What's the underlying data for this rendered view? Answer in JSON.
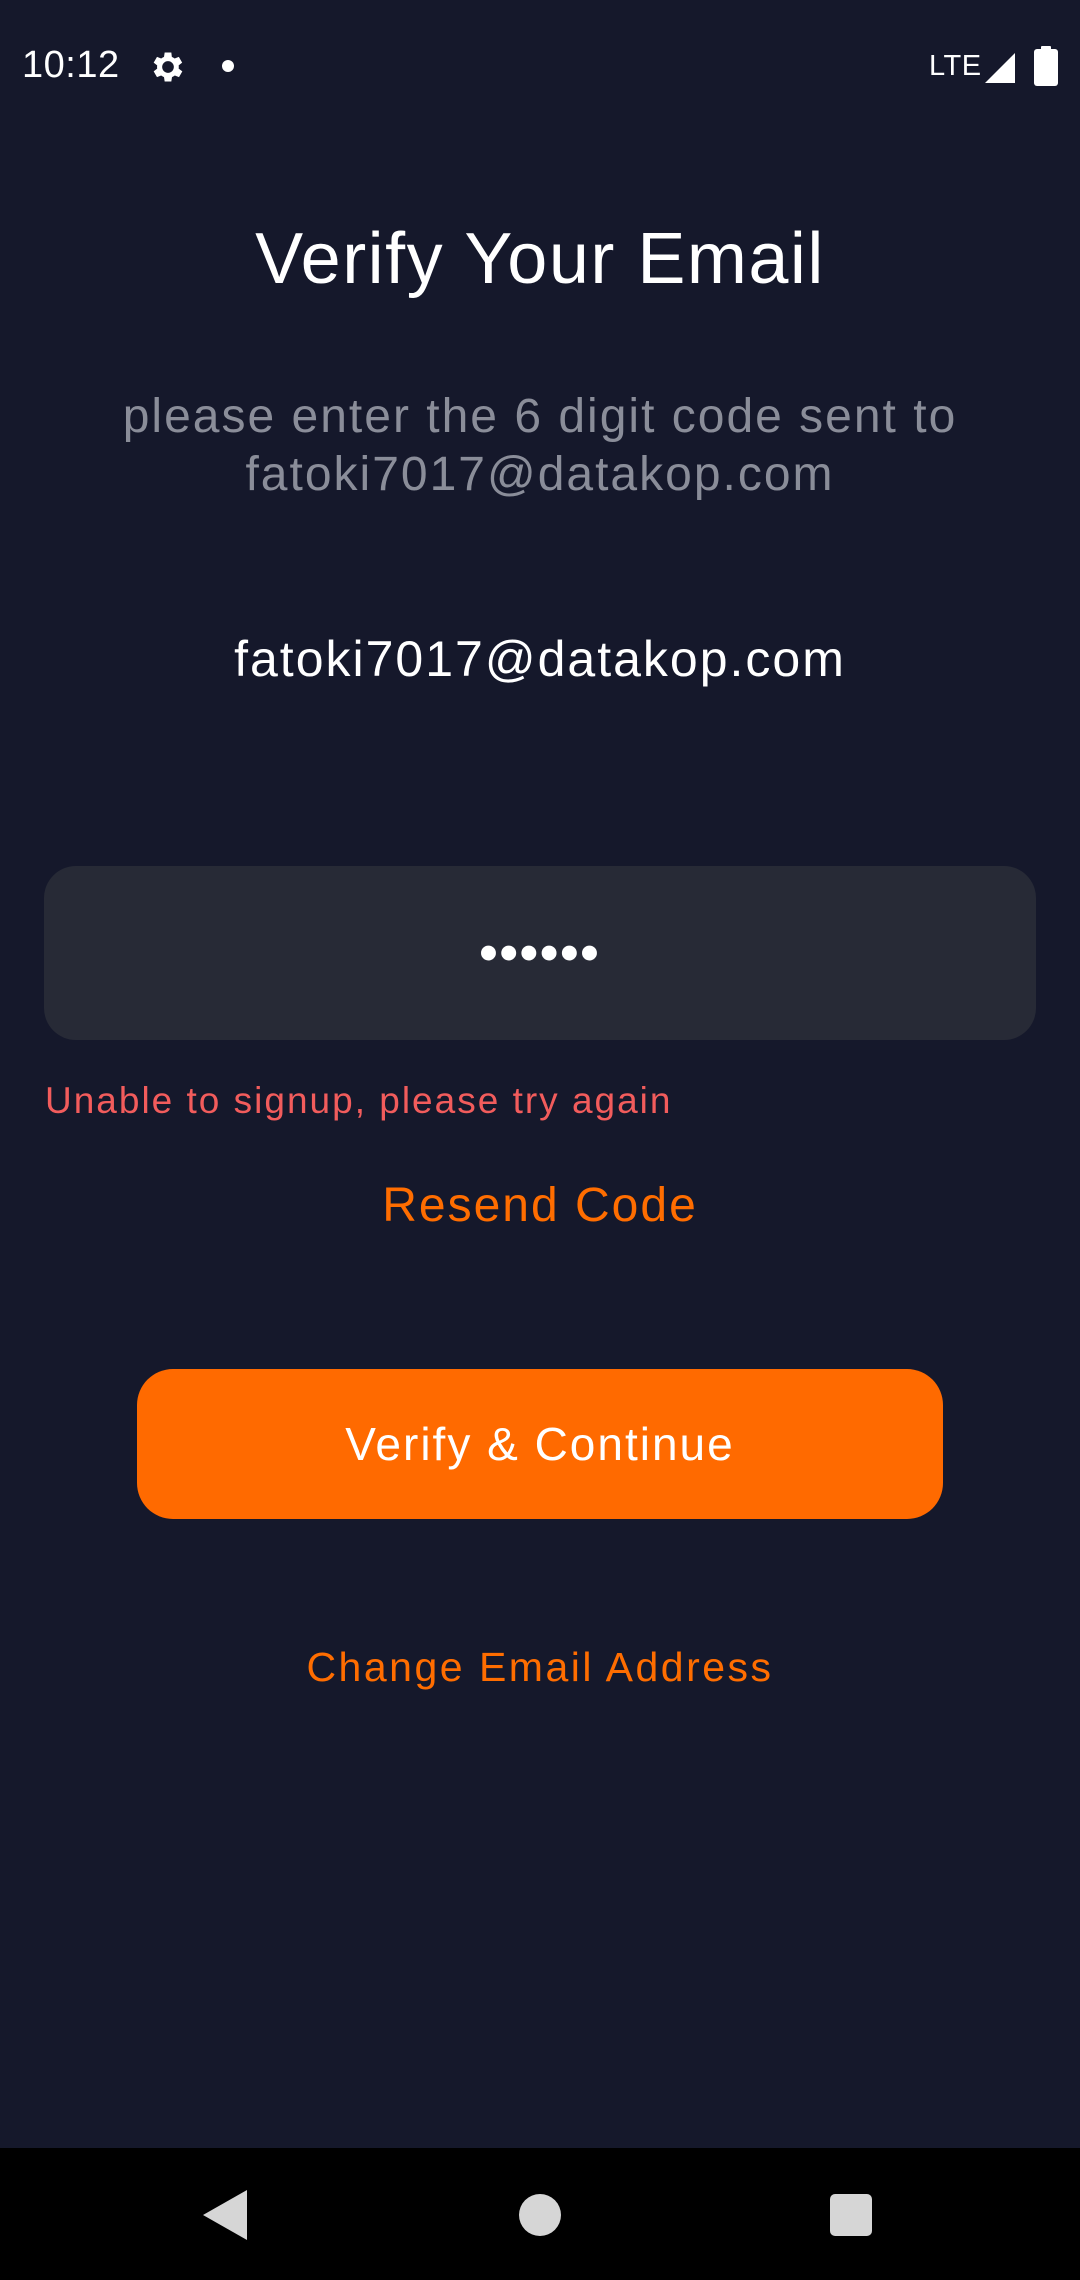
{
  "status_bar": {
    "time": "10:12",
    "network": "LTE",
    "icons": [
      "settings-gear-icon",
      "notification-dot-icon",
      "cell-signal-icon",
      "battery-icon"
    ]
  },
  "screen": {
    "title": "Verify Your Email",
    "subtitle": "please enter the 6 digit code sent to fatoki7017@datakop.com",
    "email": "fatoki7017@datakop.com",
    "code_input": {
      "value": "123456",
      "type": "password"
    },
    "error_message": "Unable to signup, please try again",
    "resend_label": "Resend Code",
    "verify_button_label": "Verify & Continue",
    "change_email_label": "Change Email Address"
  },
  "nav_bar": {
    "icons": [
      "back-icon",
      "home-icon",
      "recents-icon"
    ]
  },
  "colors": {
    "background": "#15182b",
    "input_background": "#272a36",
    "accent": "#ff6a00",
    "error": "#f25c5c",
    "subtitle": "#8a8d99"
  }
}
